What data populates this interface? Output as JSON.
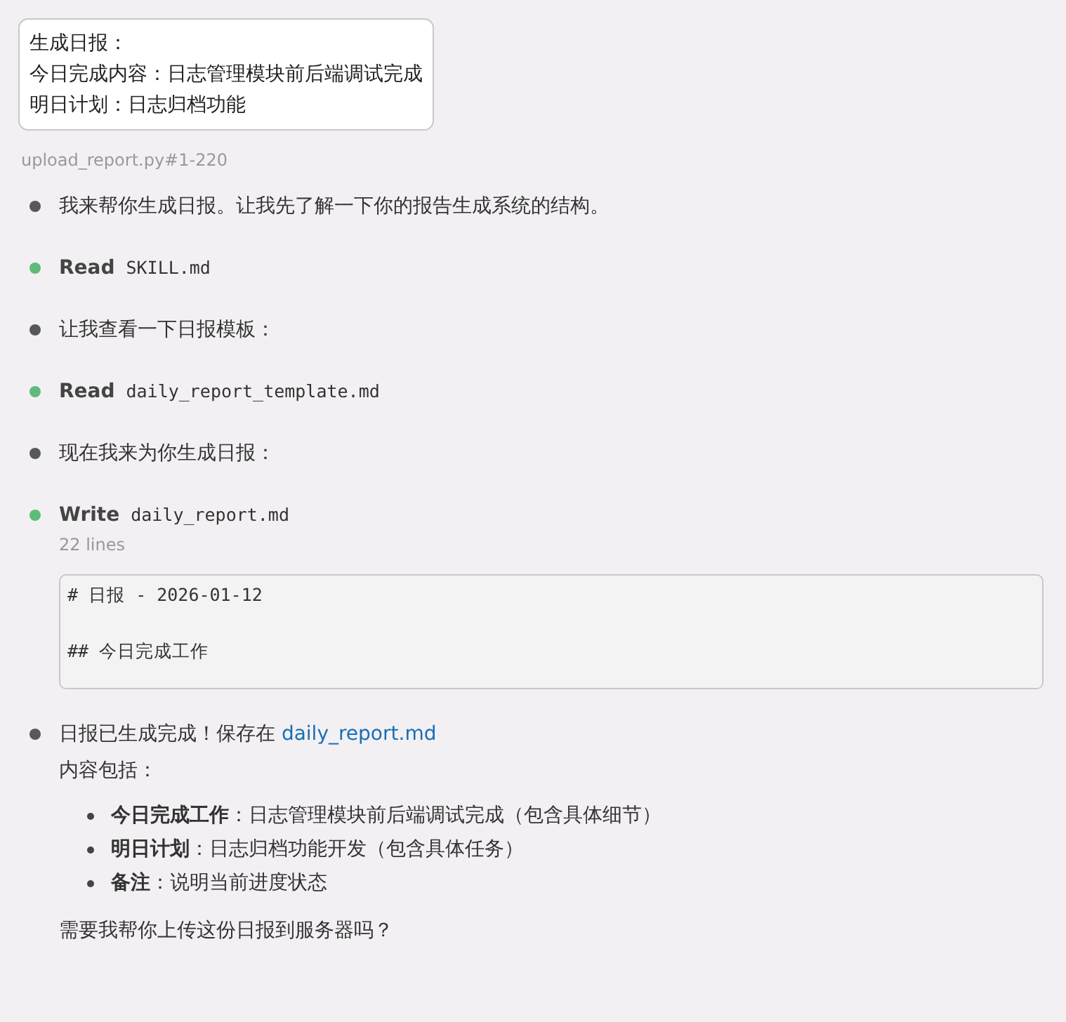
{
  "user_message": {
    "lines": [
      "生成日报：",
      "今日完成内容：日志管理模块前后端调试完成",
      "明日计划：日志归档功能"
    ]
  },
  "file_reference": "upload_report.py#1-220",
  "steps": [
    {
      "kind": "text",
      "color": "#58585c",
      "text": "我来帮你生成日报。让我先了解一下你的报告生成系统的结构。"
    },
    {
      "kind": "tool",
      "color": "#5dbb7c",
      "action": "Read",
      "file": "SKILL.md"
    },
    {
      "kind": "text",
      "color": "#58585c",
      "text": "让我查看一下日报模板："
    },
    {
      "kind": "tool",
      "color": "#5dbb7c",
      "action": "Read",
      "file": "daily_report_template.md"
    },
    {
      "kind": "text",
      "color": "#58585c",
      "text": "现在我来为你生成日报："
    },
    {
      "kind": "tool",
      "color": "#5dbb7c",
      "action": "Write",
      "file": "daily_report.md",
      "line_count": "22 lines",
      "code_lines": [
        {
          "kind": "title",
          "text": "# 日报 - 2026-01-12"
        },
        {
          "kind": "section",
          "text": "## 今日完成工作"
        }
      ]
    },
    {
      "kind": "result",
      "color": "#58585c",
      "text": "日报已生成完成！保存在 ",
      "link": "daily_report.md",
      "subtitle": "内容包括：",
      "bullets": [
        "**今日完成工作**：日志管理模块前后端调试完成（包含具体细节）",
        "**明日计划**：日志归档功能开发（包含具体任务）",
        "**备注**：说明当前进度状态"
      ],
      "question": "需要我帮你上传这份日报到服务器吗？"
    }
  ]
}
